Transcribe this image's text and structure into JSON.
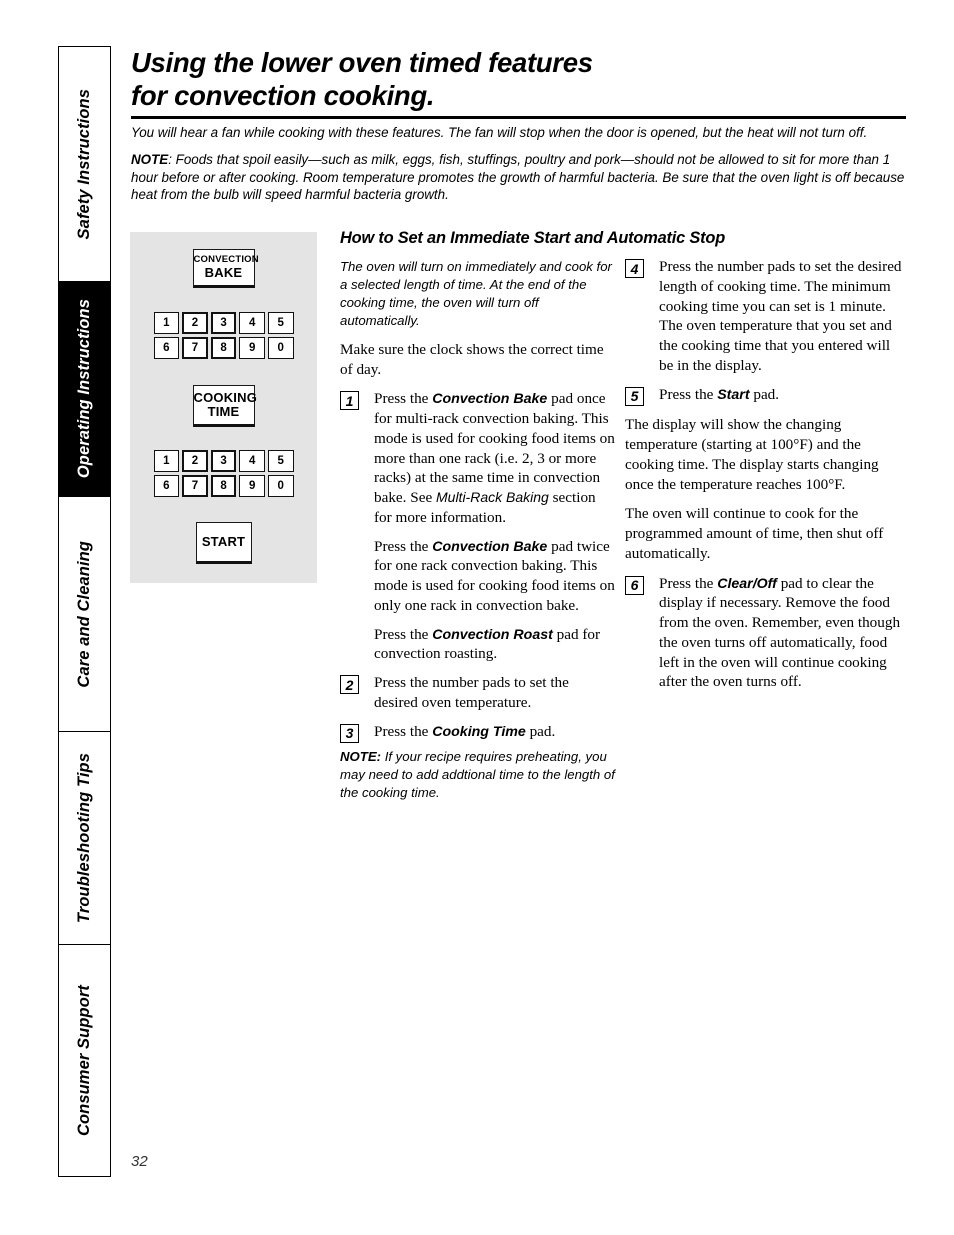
{
  "sidebar": {
    "tabs": [
      {
        "label": "Safety Instructions",
        "active": false
      },
      {
        "label": "Operating Instructions",
        "active": true
      },
      {
        "label": "Care and Cleaning",
        "active": false
      },
      {
        "label": "Troubleshooting Tips",
        "active": false
      },
      {
        "label": "Consumer Support",
        "active": false
      }
    ]
  },
  "header": {
    "title_line1": "Using the lower oven timed features",
    "title_line2": "for convection cooking."
  },
  "intro": {
    "para1": "You will hear a fan while cooking with these features. The fan will stop when the door is opened, but the heat will not turn off.",
    "note_label": "NOTE",
    "note_text": ": Foods that spoil easily—such as milk, eggs, fish, stuffings, poultry and pork—should not be allowed to sit for more than 1 hour before or after cooking. Room temperature promotes the growth of harmful bacteria. Be sure that the oven light is off because heat from the bulb will speed harmful bacteria growth."
  },
  "panel": {
    "convection_bake_line1": "CONVECTION",
    "convection_bake_line2": "BAKE",
    "cooking_time_line1": "COOKING",
    "cooking_time_line2": "TIME",
    "start_label": "START",
    "numpad_row1": [
      "1",
      "2",
      "3",
      "4",
      "5"
    ],
    "numpad_row2": [
      "6",
      "7",
      "8",
      "9",
      "0"
    ],
    "numpad_bold_row1": [
      false,
      true,
      true,
      false,
      false
    ],
    "numpad_bold_row2": [
      false,
      true,
      true,
      false,
      false
    ],
    "background_color": "#e4e4e4"
  },
  "section": {
    "heading": "How to Set an Immediate Start and Automatic Stop",
    "intro_italic": "The oven will turn on immediately and cook for a selected length of time. At the end of the cooking time, the oven will turn off automatically.",
    "clock_note": "Make sure the clock shows the correct time of day."
  },
  "steps": {
    "s1_num": "1",
    "s1_a_pre": "Press the ",
    "s1_a_pad": "Convection Bake",
    "s1_a_post": " pad once for multi-rack convection baking. This mode is used for cooking food items on more than one rack (i.e. 2, 3 or more racks) at the same time in convection bake. See ",
    "s1_a_ref": "Multi-Rack Baking",
    "s1_a_tail": " section for more information.",
    "s1_b_pre": "Press the ",
    "s1_b_pad": "Convection Bake",
    "s1_b_post": " pad twice for one rack convection baking. This mode is used for cooking food items on only one rack in convection bake.",
    "s1_c_pre": "Press the ",
    "s1_c_pad": "Convection Roast",
    "s1_c_post": " pad for convection roasting.",
    "s2_num": "2",
    "s2_text": "Press the number pads to set the desired oven temperature.",
    "s3_num": "3",
    "s3_pre": "Press the ",
    "s3_pad": "Cooking Time",
    "s3_post": " pad.",
    "s4_num": "4",
    "s4_text": "Press the number pads to set the desired length of cooking time. The minimum cooking time you can set is 1 minute. The oven temperature that you set and the cooking time that you entered will be in the display.",
    "s5_num": "5",
    "s5_pre": "Press the ",
    "s5_pad": "Start",
    "s5_post": " pad.",
    "s6_num": "6",
    "s6_pre": "Press the ",
    "s6_pad": "Clear/Off",
    "s6_post": " pad to clear the display if necessary. Remove the food from the oven. Remember, even though the oven turns off automatically, food left in the oven will continue cooking after the oven turns off."
  },
  "notes": {
    "mid_note_label": "NOTE:",
    "mid_note_text": " If your recipe requires preheating, you may need to add addtional time to the length of the cooking time."
  },
  "right_paras": {
    "p1": "The display will show the changing temperature (starting at 100°F) and the cooking time. The display starts changing once the temperature reaches 100°F.",
    "p2": "The oven will continue to cook for the programmed amount of time, then shut off automatically."
  },
  "footer": {
    "page_number": "32"
  }
}
